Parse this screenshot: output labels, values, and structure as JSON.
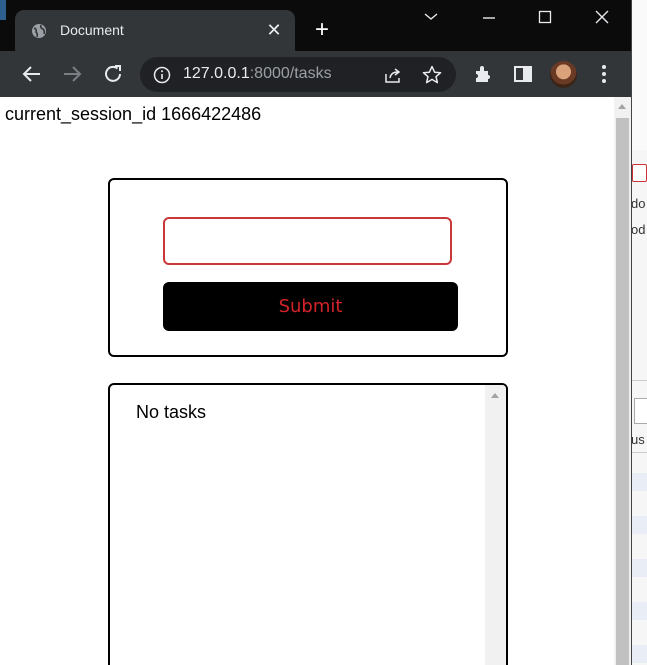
{
  "browser": {
    "tab_title": "Document",
    "tab_close": "✕",
    "new_tab": "+",
    "url_host": "127.0.0.1",
    "url_rest": ":8000/tasks"
  },
  "page": {
    "session_label": "current_session_id 1666422486",
    "task_input": {
      "value": "",
      "placeholder": ""
    },
    "submit_label": "Submit",
    "empty_message": "No tasks"
  },
  "colors": {
    "input_border": "#c8383b",
    "submit_bg": "#000000",
    "submit_text": "#d2232a",
    "tab_bg": "#323639",
    "titlebar_bg": "#0b0b0b"
  },
  "icons": {
    "tab": "globe-icon",
    "toolbar": [
      "back-arrow-icon",
      "forward-arrow-icon",
      "reload-icon",
      "info-icon",
      "share-icon",
      "star-icon",
      "extensions-icon",
      "side-panel-icon",
      "menu-dots-icon"
    ],
    "window": [
      "tab-search-chevron-icon",
      "minimize-icon",
      "maximize-icon",
      "close-window-icon"
    ]
  }
}
